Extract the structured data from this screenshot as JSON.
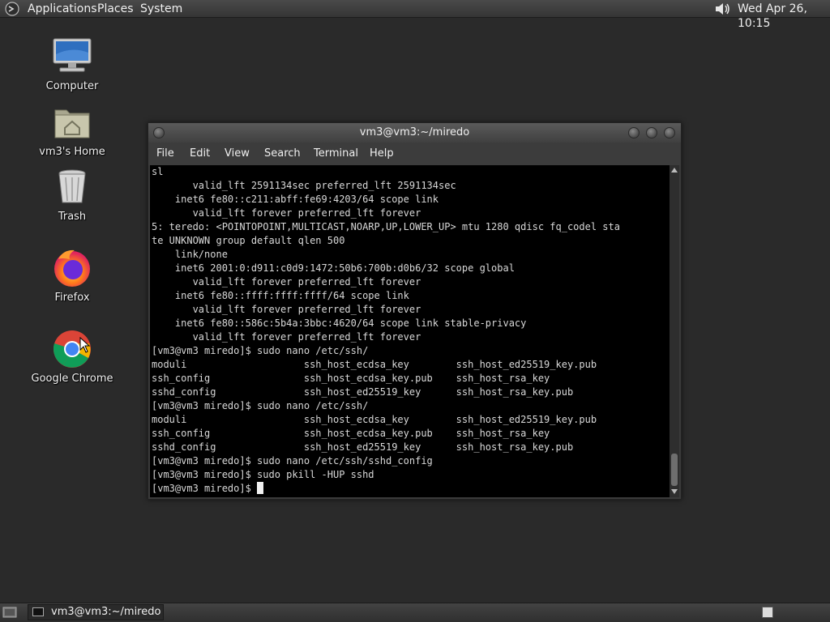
{
  "top_panel": {
    "menus": [
      "Applications",
      "Places",
      "System"
    ],
    "clock": "Wed Apr 26, 10:15"
  },
  "desktop": {
    "icons": [
      {
        "label": "Computer",
        "icon": "computer-icon"
      },
      {
        "label": "vm3's Home",
        "icon": "home-folder-icon"
      },
      {
        "label": "Trash",
        "icon": "trash-icon"
      },
      {
        "label": "Firefox",
        "icon": "firefox-icon"
      },
      {
        "label": "Google Chrome",
        "icon": "chrome-icon"
      }
    ]
  },
  "terminal": {
    "title": "vm3@vm3:~/miredo",
    "menu": [
      "File",
      "Edit",
      "View",
      "Search",
      "Terminal",
      "Help"
    ],
    "lines": [
      "sl",
      "       valid_lft 2591134sec preferred_lft 2591134sec",
      "    inet6 fe80::c211:abff:fe69:4203/64 scope link",
      "       valid_lft forever preferred_lft forever",
      "5: teredo: <POINTOPOINT,MULTICAST,NOARP,UP,LOWER_UP> mtu 1280 qdisc fq_codel sta",
      "te UNKNOWN group default qlen 500",
      "    link/none",
      "    inet6 2001:0:d911:c0d9:1472:50b6:700b:d0b6/32 scope global",
      "       valid_lft forever preferred_lft forever",
      "    inet6 fe80::ffff:ffff:ffff/64 scope link",
      "       valid_lft forever preferred_lft forever",
      "    inet6 fe80::586c:5b4a:3bbc:4620/64 scope link stable-privacy",
      "       valid_lft forever preferred_lft forever",
      "[vm3@vm3 miredo]$ sudo nano /etc/ssh/",
      "moduli                    ssh_host_ecdsa_key        ssh_host_ed25519_key.pub",
      "ssh_config                ssh_host_ecdsa_key.pub    ssh_host_rsa_key",
      "sshd_config               ssh_host_ed25519_key      ssh_host_rsa_key.pub",
      "[vm3@vm3 miredo]$ sudo nano /etc/ssh/",
      "moduli                    ssh_host_ecdsa_key        ssh_host_ed25519_key.pub",
      "ssh_config                ssh_host_ecdsa_key.pub    ssh_host_rsa_key",
      "sshd_config               ssh_host_ed25519_key      ssh_host_rsa_key.pub",
      "[vm3@vm3 miredo]$ sudo nano /etc/ssh/sshd_config",
      "[vm3@vm3 miredo]$ sudo pkill -HUP sshd"
    ],
    "prompt": "[vm3@vm3 miredo]$ "
  },
  "bottom_panel": {
    "task_label": "vm3@vm3:~/miredo"
  }
}
